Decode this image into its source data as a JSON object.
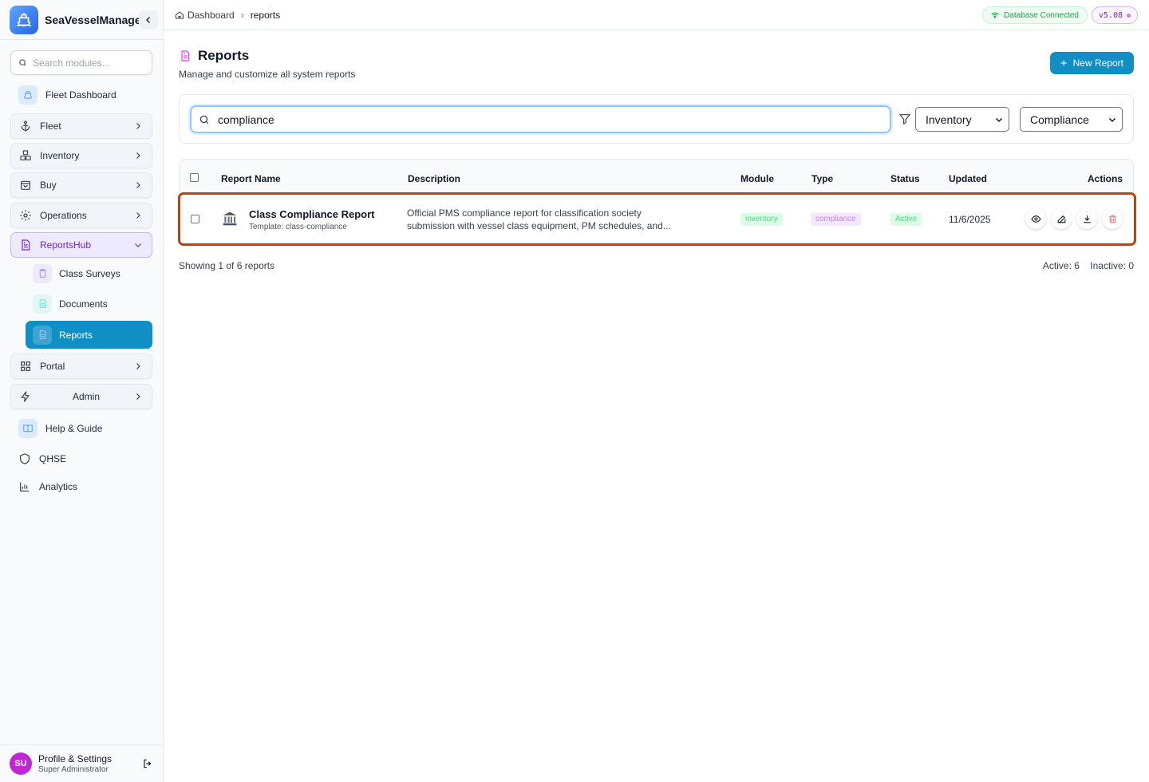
{
  "app": {
    "name": "SeaVesselManager"
  },
  "sidebar": {
    "search_placeholder": "Search modules...",
    "items": [
      {
        "label": "Fleet Dashboard",
        "icon": "ship-icon"
      },
      {
        "label": "Fleet",
        "icon": "anchor-icon"
      },
      {
        "label": "Inventory",
        "icon": "boxes-icon"
      },
      {
        "label": "Buy",
        "icon": "cart-icon"
      },
      {
        "label": "Operations",
        "icon": "gear-icon"
      },
      {
        "label": "ReportsHub",
        "icon": "document-icon"
      },
      {
        "label": "Portal",
        "icon": "grid-icon"
      },
      {
        "label": "Admin",
        "icon": "bolt-icon"
      },
      {
        "label": "Help & Guide",
        "icon": "book-icon"
      },
      {
        "label": "QHSE",
        "icon": "shield-icon"
      },
      {
        "label": "Analytics",
        "icon": "bar-chart-icon"
      }
    ],
    "subitems": [
      {
        "label": "Class Surveys",
        "icon": "clipboard-icon"
      },
      {
        "label": "Documents",
        "icon": "file-icon"
      },
      {
        "label": "Reports",
        "icon": "report-icon"
      }
    ],
    "profile": {
      "initials": "SU",
      "name": "Profile & Settings",
      "role": "Super Administrator"
    }
  },
  "topbar": {
    "breadcrumb": {
      "home": "Dashboard",
      "current": "reports"
    },
    "db_status": "Database Connected",
    "version": "v5.08"
  },
  "page": {
    "title": "Reports",
    "subtitle": "Manage and customize all system reports",
    "new_button": "New Report"
  },
  "filters": {
    "search_value": "compliance",
    "module_select": "Inventory",
    "type_select": "Compliance"
  },
  "table": {
    "headers": [
      "Report Name",
      "Description",
      "Module",
      "Type",
      "Status",
      "Updated",
      "Actions"
    ],
    "rows": [
      {
        "name": "Class Compliance Report",
        "template": "Template: class-compliance",
        "description": "Official PMS compliance report for classification society submission with vessel class equipment, PM schedules, and...",
        "module": "inventory",
        "type": "compliance",
        "status": "Active",
        "updated": "11/6/2025"
      }
    ]
  },
  "footer": {
    "showing": "Showing 1 of 6 reports",
    "active": "Active: 6",
    "inactive": "Inactive: 0"
  },
  "colors": {
    "accent": "#0f8fc3",
    "reports_group": "#6d28d9",
    "highlight": "#c2410c"
  }
}
